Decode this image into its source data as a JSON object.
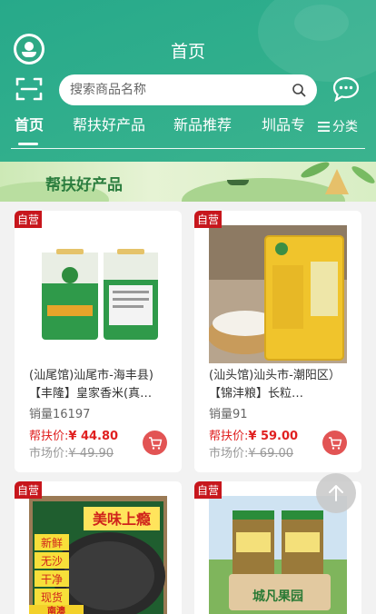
{
  "header": {
    "title": "首页",
    "search_placeholder": "搜索商品名称",
    "tabs": [
      "首页",
      "帮扶好产品",
      "新品推荐",
      "圳品专"
    ],
    "category_label": "分类"
  },
  "banner": {
    "title": "帮扶好产品"
  },
  "products": [
    {
      "badge": "自营",
      "name": "(汕尾馆)汕尾市-海丰县)【丰隆】皇家香米(真…",
      "sales": "销量16197",
      "price_label": "帮扶价:",
      "price": "¥ 44.80",
      "market_label": "市场价:",
      "market_price": "¥ 49.90"
    },
    {
      "badge": "自营",
      "name": "(汕头馆)汕头市-潮阳区）【锦沣粮】长粒…",
      "sales": "销量91",
      "price_label": "帮扶价:",
      "price": "¥ 59.00",
      "market_label": "市场价:",
      "market_price": "¥ 69.00"
    },
    {
      "badge": "自营",
      "image_text": [
        "美味上瘾",
        "新鲜",
        "无沙",
        "干净",
        "现货",
        "南澳"
      ]
    },
    {
      "badge": "自营",
      "image_text": "城凡果园"
    }
  ]
}
